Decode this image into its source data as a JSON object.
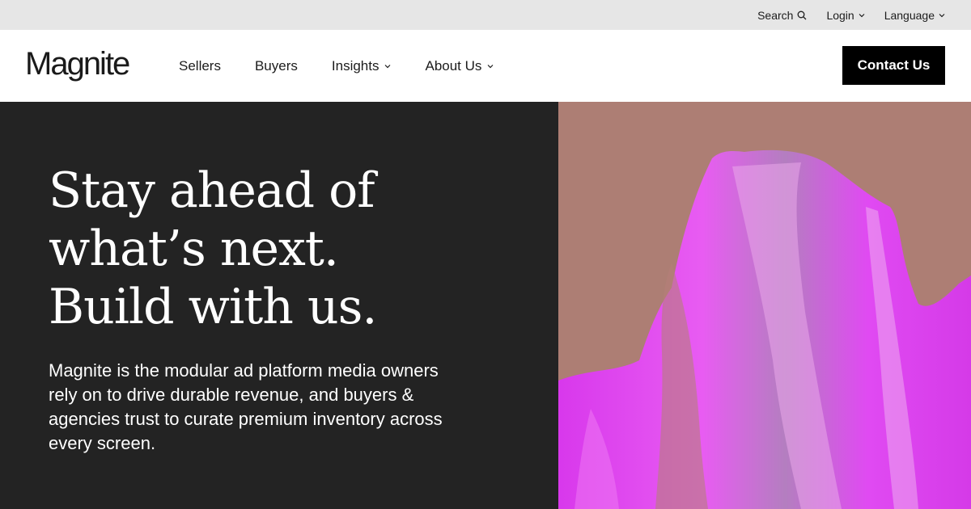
{
  "utility_bar": {
    "search_label": "Search",
    "login_label": "Login",
    "language_label": "Language"
  },
  "header": {
    "logo_text": "Magnite",
    "nav_items": [
      {
        "label": "Sellers",
        "has_dropdown": false
      },
      {
        "label": "Buyers",
        "has_dropdown": false
      },
      {
        "label": "Insights",
        "has_dropdown": true
      },
      {
        "label": "About Us",
        "has_dropdown": true
      }
    ],
    "contact_label": "Contact Us"
  },
  "hero": {
    "headline_lines": [
      "Stay ahead of",
      "what’s next.",
      "Build with us."
    ],
    "body": "Magnite is the modular ad platform media owners rely on to drive durable revenue, and buyers & agencies trust to curate premium inventory across every screen."
  },
  "colors": {
    "utility_bg": "#e6e6e6",
    "hero_dark": "#232323",
    "hero_art_bg": "#ad7e74",
    "hero_art_accent": "#e040f0",
    "button_bg": "#000000"
  },
  "icons": {
    "search": "search-icon",
    "chevron": "chevron-down-icon"
  }
}
